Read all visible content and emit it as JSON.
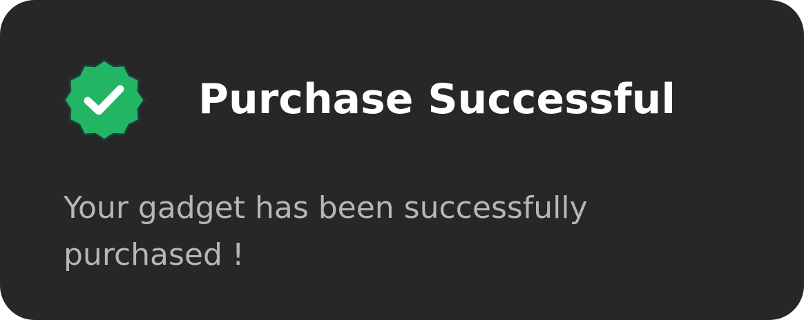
{
  "notification": {
    "title": "Purchase Successful",
    "message": "Your gadget has been successfully purchased !",
    "icon": "verified-check-badge-icon",
    "colors": {
      "background": "#272727",
      "badge": "#22B664",
      "title": "#FFFFFF",
      "message": "#B6B6B6"
    }
  }
}
